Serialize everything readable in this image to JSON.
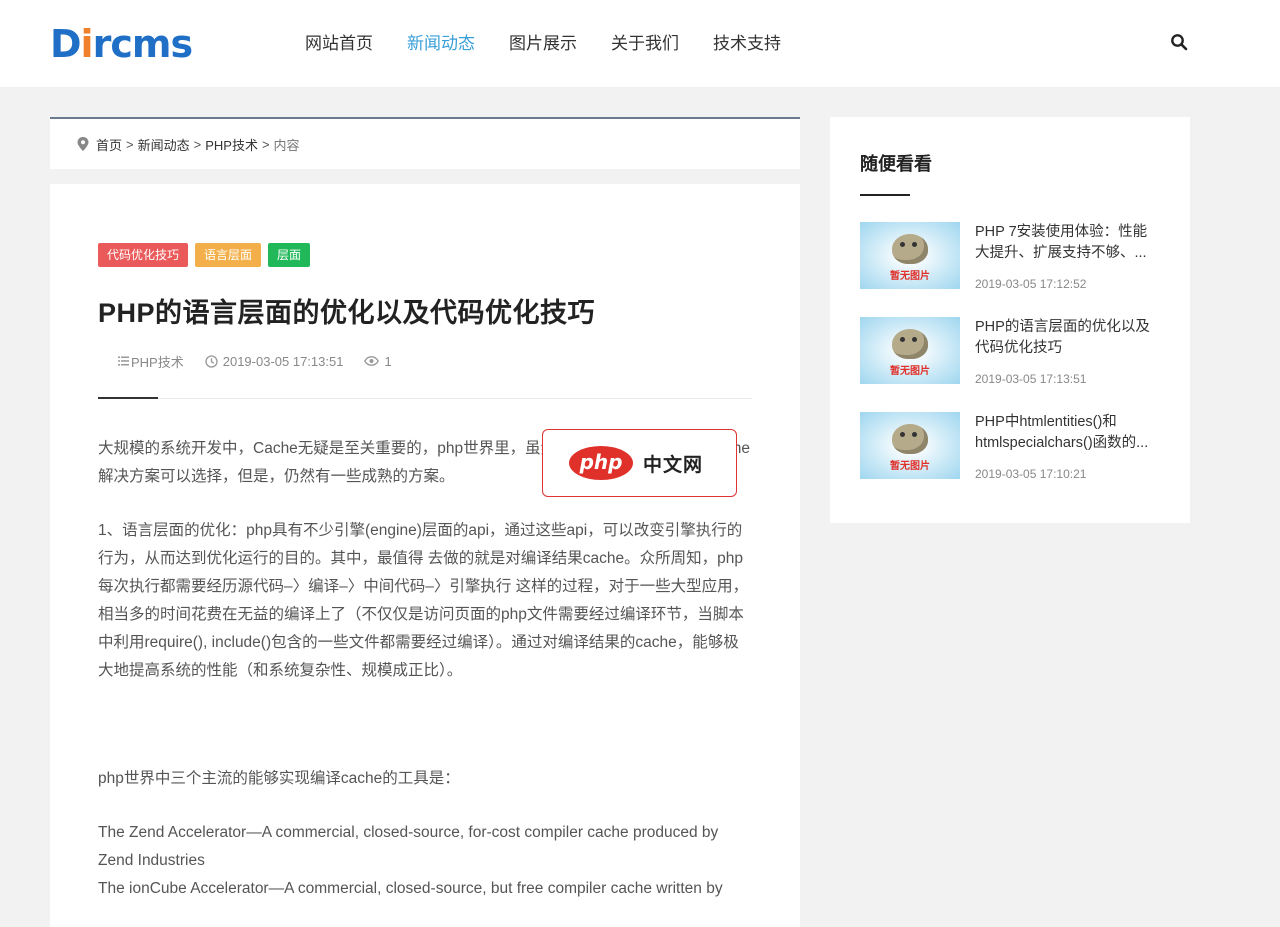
{
  "header": {
    "logo": {
      "d": "D",
      "i": "i",
      "rest": "rcms"
    },
    "nav": [
      {
        "label": "网站首页",
        "active": false
      },
      {
        "label": "新闻动态",
        "active": true
      },
      {
        "label": "图片展示",
        "active": false
      },
      {
        "label": "关于我们",
        "active": false
      },
      {
        "label": "技术支持",
        "active": false
      }
    ],
    "search_icon": "search-icon"
  },
  "breadcrumb": {
    "items": [
      "首页",
      "新闻动态",
      "PHP技术"
    ],
    "separator": ">",
    "current": "内容"
  },
  "article": {
    "tags": [
      "代码优化技巧",
      "语言层面",
      "层面"
    ],
    "title": "PHP的语言层面的优化以及代码优化技巧",
    "meta": {
      "category": "PHP技术",
      "datetime": "2019-03-05 17:13:51",
      "views": "1"
    },
    "paragraphs": [
      "大规模的系统开发中，Cache无疑是至关重要的，php世界里，虽然没有如java一样丰富的cache解决方案可以选择，但是，仍然有一些成熟的方案。",
      "1、语言层面的优化：php具有不少引擎(engine)层面的api，通过这些api，可以改变引擎执行的行为，从而达到优化运行的目的。其中，最值得 去做的就是对编译结果cache。众所周知，php每次执行都需要经历源代码–〉编译–〉中间代码–〉引擎执行 这样的过程，对于一些大型应用，相当多的时间花费在无益的编译上了（不仅仅是访问页面的php文件需要经过编译环节，当脚本中利用require(), include()包含的一些文件都需要经过编译）。通过对编译结果的cache，能够极大地提高系统的性能（和系统复杂性、规模成正比）。",
      "php世界中三个主流的能够实现编译cache的工具是：",
      "The Zend Accelerator—A commercial, closed-source, for-cost compiler cache produced by Zend Industries",
      "The ionCube Accelerator—A commercial, closed-source, but free compiler cache written by"
    ]
  },
  "watermark": {
    "brand": "php",
    "text": "中文网"
  },
  "sidebar": {
    "title": "随便看看",
    "items": [
      {
        "title": "PHP 7安装使用体验：性能大提升、扩展支持不够、...",
        "date": "2019-03-05 17:12:52",
        "thumb_label": "暂无图片"
      },
      {
        "title": "PHP的语言层面的优化以及代码优化技巧",
        "date": "2019-03-05 17:13:51",
        "thumb_label": "暂无图片"
      },
      {
        "title": "PHP中htmlentities()和htmlspecialchars()函数的...",
        "date": "2019-03-05 17:10:21",
        "thumb_label": "暂无图片"
      }
    ]
  },
  "colors": {
    "nav_active": "#3a9fd8",
    "tag1": "#ea5a5a",
    "tag2": "#f3b04a",
    "tag3": "#21b85a",
    "logo_blue": "#1f6fc7",
    "logo_orange": "#f0812a"
  }
}
